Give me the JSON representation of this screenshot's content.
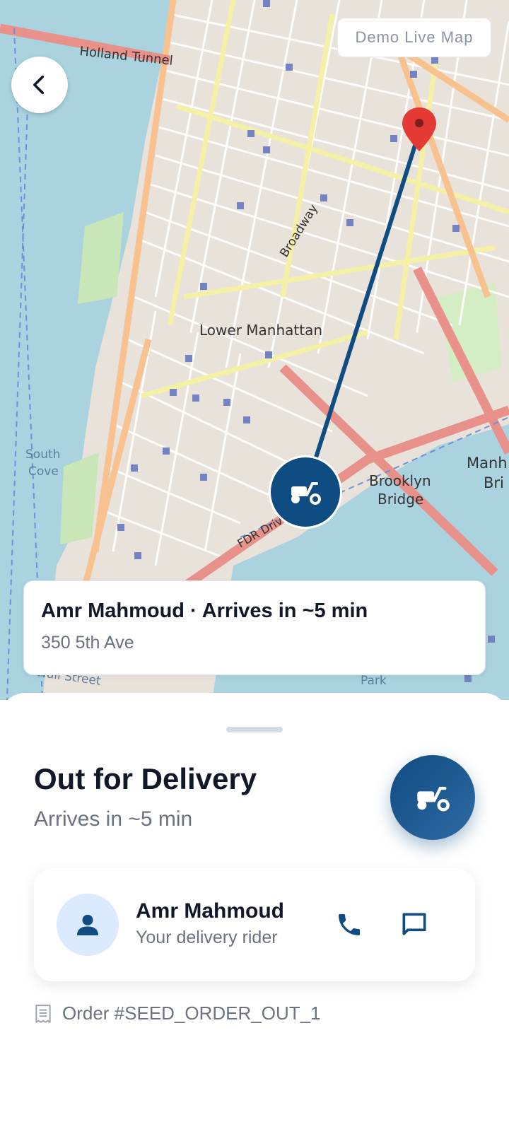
{
  "map": {
    "badge": "Demo Live Map",
    "labels": {
      "holland_tunnel": "Holland Tunnel",
      "broadway": "Broadway",
      "lower_manhattan": "Lower Manhattan",
      "brooklyn": "Brooklyn",
      "bridge": "Bridge",
      "fdr_drive": "FDR Drive",
      "south_cove": "South",
      "cove": "Cove",
      "manh": "Manh",
      "bri": "Bri",
      "wall_street": "Wall Street",
      "park": "Park"
    },
    "route_color": "#0f4c81",
    "pin_color": "#e53935",
    "icons": {
      "back": "chevron-left-icon",
      "pin": "location-pin-icon",
      "rider": "scooter-icon"
    }
  },
  "eta_card": {
    "title": "Amr Mahmoud · Arrives in ~5 min",
    "address": "350 5th Ave"
  },
  "sheet": {
    "status_title": "Out for Delivery",
    "status_sub": "Arrives in ~5 min",
    "rider": {
      "name": "Amr Mahmoud",
      "role": "Your delivery rider"
    },
    "order_label": "Order #SEED_ORDER_OUT_1",
    "icons": {
      "status": "scooter-icon",
      "avatar": "person-icon",
      "call": "phone-icon",
      "message": "chat-icon",
      "order": "receipt-icon"
    },
    "accent": "#0f4c81"
  }
}
